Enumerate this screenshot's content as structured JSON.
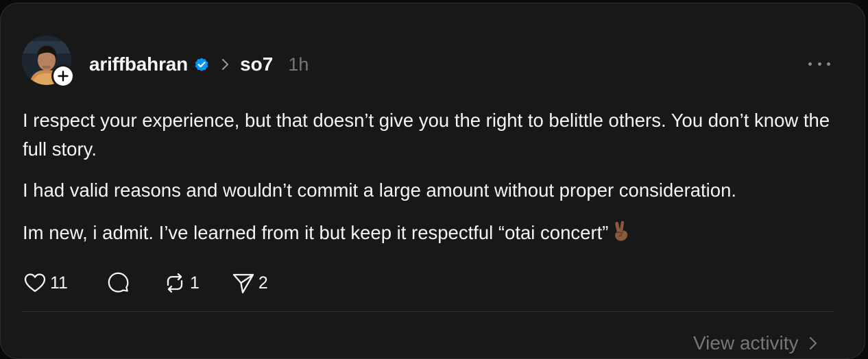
{
  "post": {
    "author": {
      "username": "ariffbahran",
      "verified": true,
      "avatar_icon": "profile-photo"
    },
    "community": "so7",
    "time": "1h",
    "paragraphs": [
      "I respect your experience, but that doesn’t give you the right to belittle others. You don’t know the full story.",
      "I had valid reasons and wouldn’t commit a large amount without proper consideration.",
      "Im new, i admit. I’ve learned from it but keep it respectful “otai concert”"
    ],
    "trailing_emoji": "victory-hand-medium-dark-skin-tone",
    "actions": {
      "likes": "11",
      "replies": "",
      "reposts": "1",
      "shares": "2"
    },
    "view_activity_label": "View activity"
  },
  "colors": {
    "background": "#181818",
    "text": "#f3f5f7",
    "muted": "#777777",
    "verified": "#0095f6"
  }
}
